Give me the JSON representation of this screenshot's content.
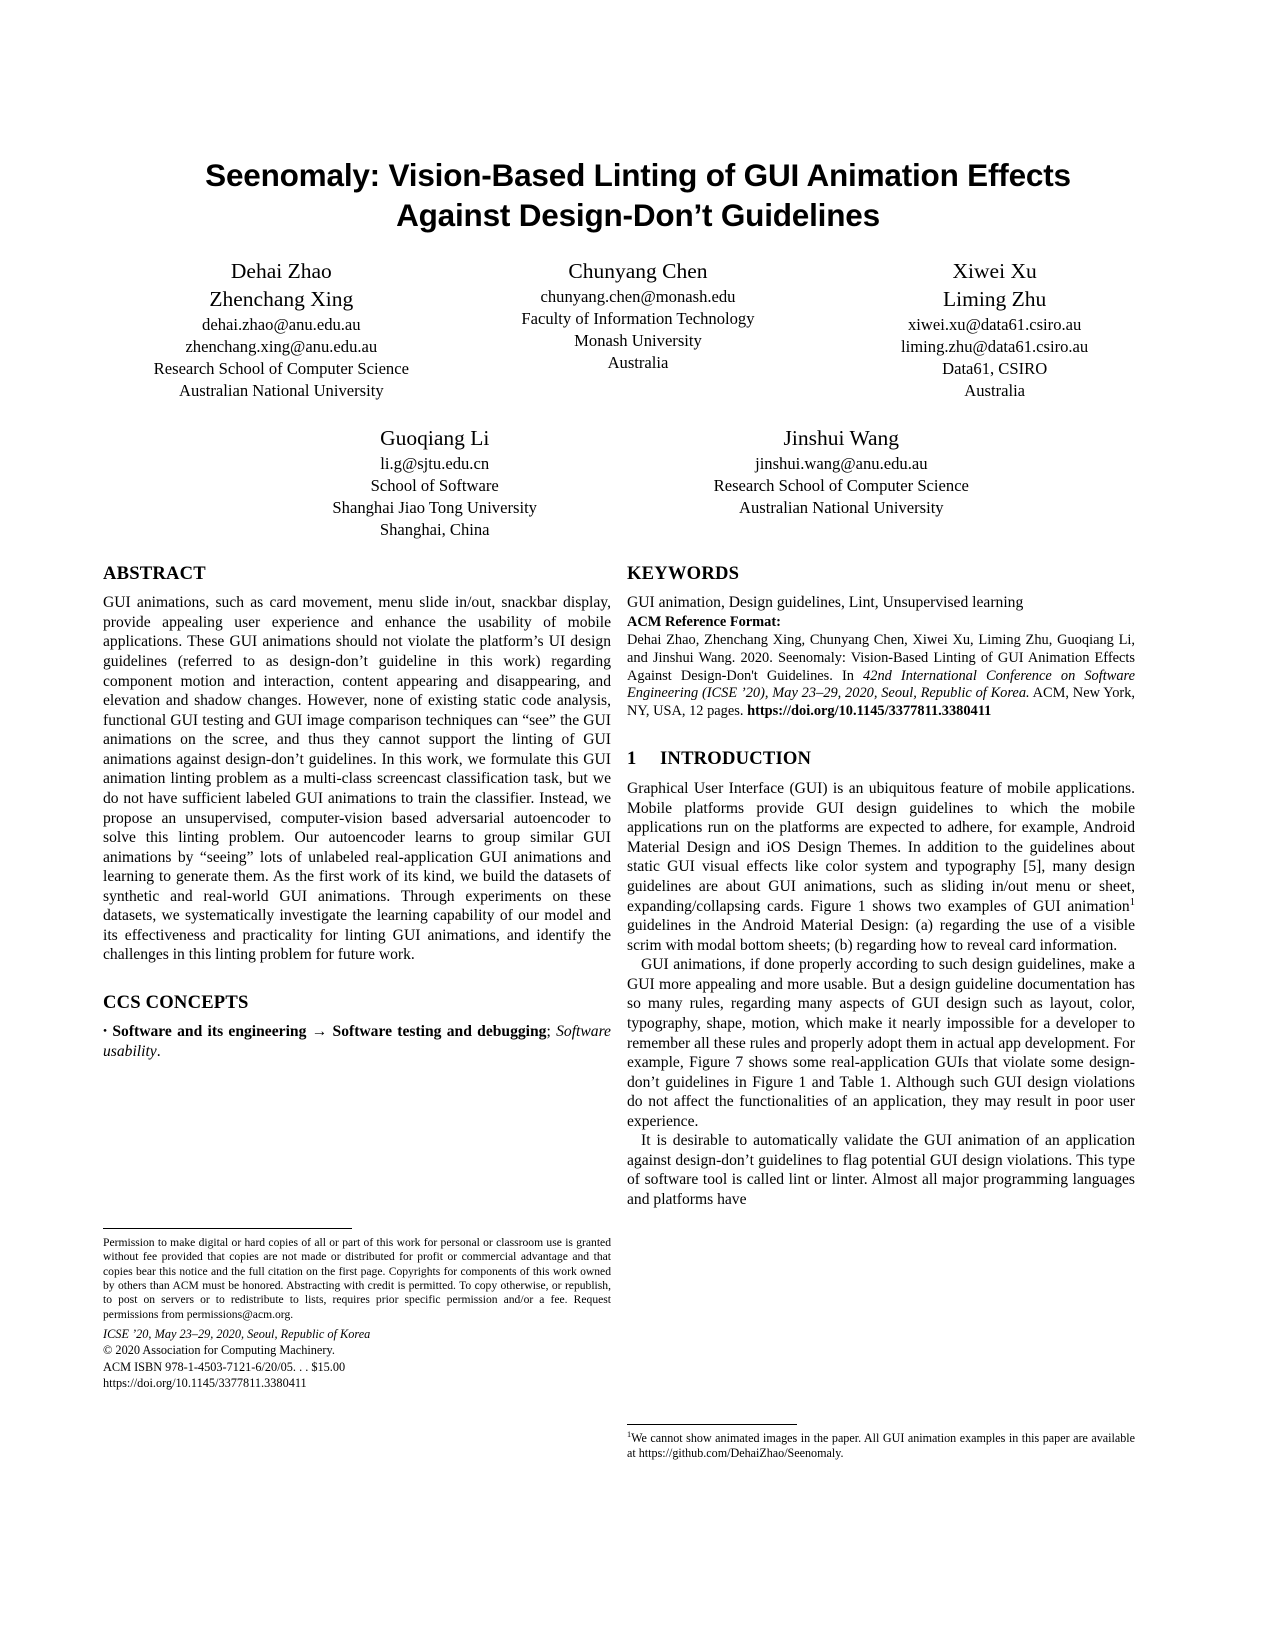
{
  "title": "Seenomaly: Vision-Based Linting of GUI Animation Effects Against Design-Don't Guidelines",
  "title_line1": "Seenomaly: Vision-Based Linting of GUI Animation Effects",
  "title_line2": "Against Design-Don’t Guidelines",
  "authors": {
    "row1": [
      {
        "names": [
          "Dehai Zhao",
          "Zhenchang Xing"
        ],
        "lines": [
          "dehai.zhao@anu.edu.au",
          "zhenchang.xing@anu.edu.au",
          "Research School of Computer Science",
          "Australian National University"
        ]
      },
      {
        "names": [
          "Chunyang Chen"
        ],
        "lines": [
          "chunyang.chen@monash.edu",
          "Faculty of Information Technology",
          "Monash University",
          "Australia"
        ]
      },
      {
        "names": [
          "Xiwei Xu",
          "Liming Zhu"
        ],
        "lines": [
          "xiwei.xu@data61.csiro.au",
          "liming.zhu@data61.csiro.au",
          "Data61, CSIRO",
          "Australia"
        ]
      }
    ],
    "row2": [
      {
        "names": [
          "Guoqiang Li"
        ],
        "lines": [
          "li.g@sjtu.edu.cn",
          "School of Software",
          "Shanghai Jiao Tong University",
          "Shanghai, China"
        ]
      },
      {
        "names": [
          "Jinshui Wang"
        ],
        "lines": [
          "jinshui.wang@anu.edu.au",
          "Research School of Computer Science",
          "Australian National University"
        ]
      }
    ]
  },
  "abstract": {
    "heading": "ABSTRACT",
    "text": "GUI animations, such as card movement, menu slide in/out, snackbar display, provide appealing user experience and enhance the usability of mobile applications. These GUI animations should not violate the platform’s UI design guidelines (referred to as design-don’t guideline in this work) regarding component motion and interaction, content appearing and disappearing, and elevation and shadow changes. However, none of existing static code analysis, functional GUI testing and GUI image comparison techniques can “see” the GUI animations on the scree, and thus they cannot support the linting of GUI animations against design-don’t guidelines. In this work, we formulate this GUI animation linting problem as a multi-class screencast classification task, but we do not have sufficient labeled GUI animations to train the classifier. Instead, we propose an unsupervised, computer-vision based adversarial autoencoder to solve this linting problem. Our autoencoder learns to group similar GUI animations by “seeing” lots of unlabeled real-application GUI animations and learning to generate them. As the first work of its kind, we build the datasets of synthetic and real-world GUI animations. Through experiments on these datasets, we systematically investigate the learning capability of our model and its effectiveness and practicality for linting GUI animations, and identify the challenges in this linting problem for future work."
  },
  "ccs": {
    "heading": "CCS CONCEPTS",
    "bullet": "•",
    "bold1": "Software and its engineering",
    "arrow": "→",
    "bold2": "Software testing and debugging",
    "semicolon": ";",
    "italic": "Software usability",
    "period": "."
  },
  "keywords": {
    "heading": "KEYWORDS",
    "text": "GUI animation, Design guidelines, Lint, Unsupervised learning"
  },
  "acm_reference": {
    "heading": "ACM Reference Format:",
    "part1": "Dehai Zhao, Zhenchang Xing, Chunyang Chen, Xiwei Xu, Liming Zhu, Guoqiang Li, and Jinshui Wang. 2020. Seenomaly: Vision-Based Linting of GUI Animation Effects Against Design-Don't Guidelines. In ",
    "italic1": "42nd International Conference on Software Engineering (ICSE ’20), May 23–29, 2020, Seoul, Republic of Korea.",
    "part2": " ACM, New York, NY, USA, 12 pages. ",
    "bold_doi": "https://doi.org/10.1145/3377811.3380411"
  },
  "introduction": {
    "number": "1",
    "heading": "INTRODUCTION",
    "para1": "Graphical User Interface (GUI) is an ubiquitous feature of mobile applications. Mobile platforms provide GUI design guidelines to which the mobile applications run on the platforms are expected to adhere, for example, Android Material Design and iOS Design Themes. In addition to the guidelines about static GUI visual effects like color system and typography [5], many design guidelines are about GUI animations, such as sliding in/out menu or sheet, expanding/collapsing cards. Figure 1 shows two examples of GUI animation",
    "para1_footnote_marker": "1",
    "para1_cont": " guidelines in the Android Material Design: (a) regarding the use of a visible scrim with modal bottom sheets; (b) regarding how to reveal card information.",
    "para2": "GUI animations, if done properly according to such design guidelines, make a GUI more appealing and more usable. But a design guideline documentation has so many rules, regarding many aspects of GUI design such as layout, color, typography, shape, motion, which make it nearly impossible for a developer to remember all these rules and properly adopt them in actual app development. For example, Figure 7 shows some real-application GUIs that violate some design-don’t guidelines in Figure 1 and Table 1. Although such GUI design violations do not affect the functionalities of an application, they may result in poor user experience.",
    "para3": "It is desirable to automatically validate the GUI animation of an application against design-don’t guidelines to flag potential GUI design violations. This type of software tool is called lint or linter. Almost all major programming languages and platforms have"
  },
  "copyright": {
    "permission": "Permission to make digital or hard copies of all or part of this work for personal or classroom use is granted without fee provided that copies are not made or distributed for profit or commercial advantage and that copies bear this notice and the full citation on the first page. Copyrights for components of this work owned by others than ACM must be honored. Abstracting with credit is permitted. To copy otherwise, or republish, to post on servers or to redistribute to lists, requires prior specific permission and/or a fee. Request permissions from permissions@acm.org.",
    "conference": "ICSE ’20, May 23–29, 2020, Seoul, Republic of Korea",
    "copyright_line": "© 2020 Association for Computing Machinery.",
    "isbn": "ACM ISBN 978-1-4503-7121-6/20/05. . . $15.00",
    "doi": "https://doi.org/10.1145/3377811.3380411"
  },
  "footnote": {
    "marker": "1",
    "text": "We cannot show animated images in the paper. All GUI animation examples in this paper are available at https://github.com/DehaiZhao/Seenomaly."
  }
}
